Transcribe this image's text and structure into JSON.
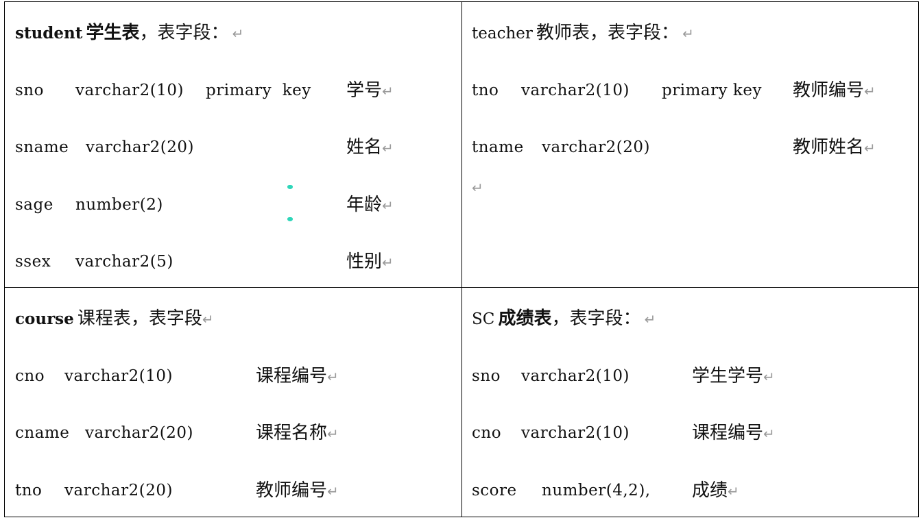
{
  "student": {
    "title_name": "student",
    "title_cn": "学生表",
    "title_rest": "，表字段：",
    "fields": [
      {
        "name": "sno",
        "type": "varchar2(10)",
        "extra": "primary  key",
        "desc": "学号"
      },
      {
        "name": "sname",
        "type": "varchar2(20)",
        "extra": "",
        "desc": "姓名"
      },
      {
        "name": "sage",
        "type": "number(2)",
        "extra": "",
        "desc": "年龄"
      },
      {
        "name": "ssex",
        "type": "varchar2(5)",
        "extra": "",
        "desc": "性别"
      }
    ]
  },
  "teacher": {
    "title_name": "teacher",
    "title_cn": "教师表",
    "title_rest": "，表字段：",
    "fields": [
      {
        "name": "tno",
        "type": "varchar2(10)",
        "extra": "primary key",
        "desc": "教师编号"
      },
      {
        "name": "tname",
        "type": "varchar2(20)",
        "extra": "",
        "desc": "教师姓名"
      }
    ]
  },
  "course": {
    "title_name": "course",
    "title_cn": "课程表",
    "title_rest": "，表字段",
    "fields": [
      {
        "name": "cno",
        "type": "varchar2(10)",
        "desc": "课程编号"
      },
      {
        "name": "cname",
        "type": "varchar2(20)",
        "desc": "课程名称"
      },
      {
        "name": "tno",
        "type": "varchar2(20)",
        "desc": "教师编号"
      }
    ]
  },
  "sc": {
    "title_name": "SC",
    "title_cn": "成绩表",
    "title_rest": "，表字段：",
    "fields": [
      {
        "name": "sno",
        "type": "varchar2(10)",
        "desc": "学生学号"
      },
      {
        "name": "cno",
        "type": "varchar2(10)",
        "desc": "课程编号"
      },
      {
        "name": "score",
        "type": "number(4,2),",
        "desc": "成绩"
      }
    ]
  },
  "paragraph_mark": "↵",
  "colors": {
    "border": "#000000",
    "paragraph_mark": "#9a9a9a",
    "marker": "#2ed6b9"
  }
}
